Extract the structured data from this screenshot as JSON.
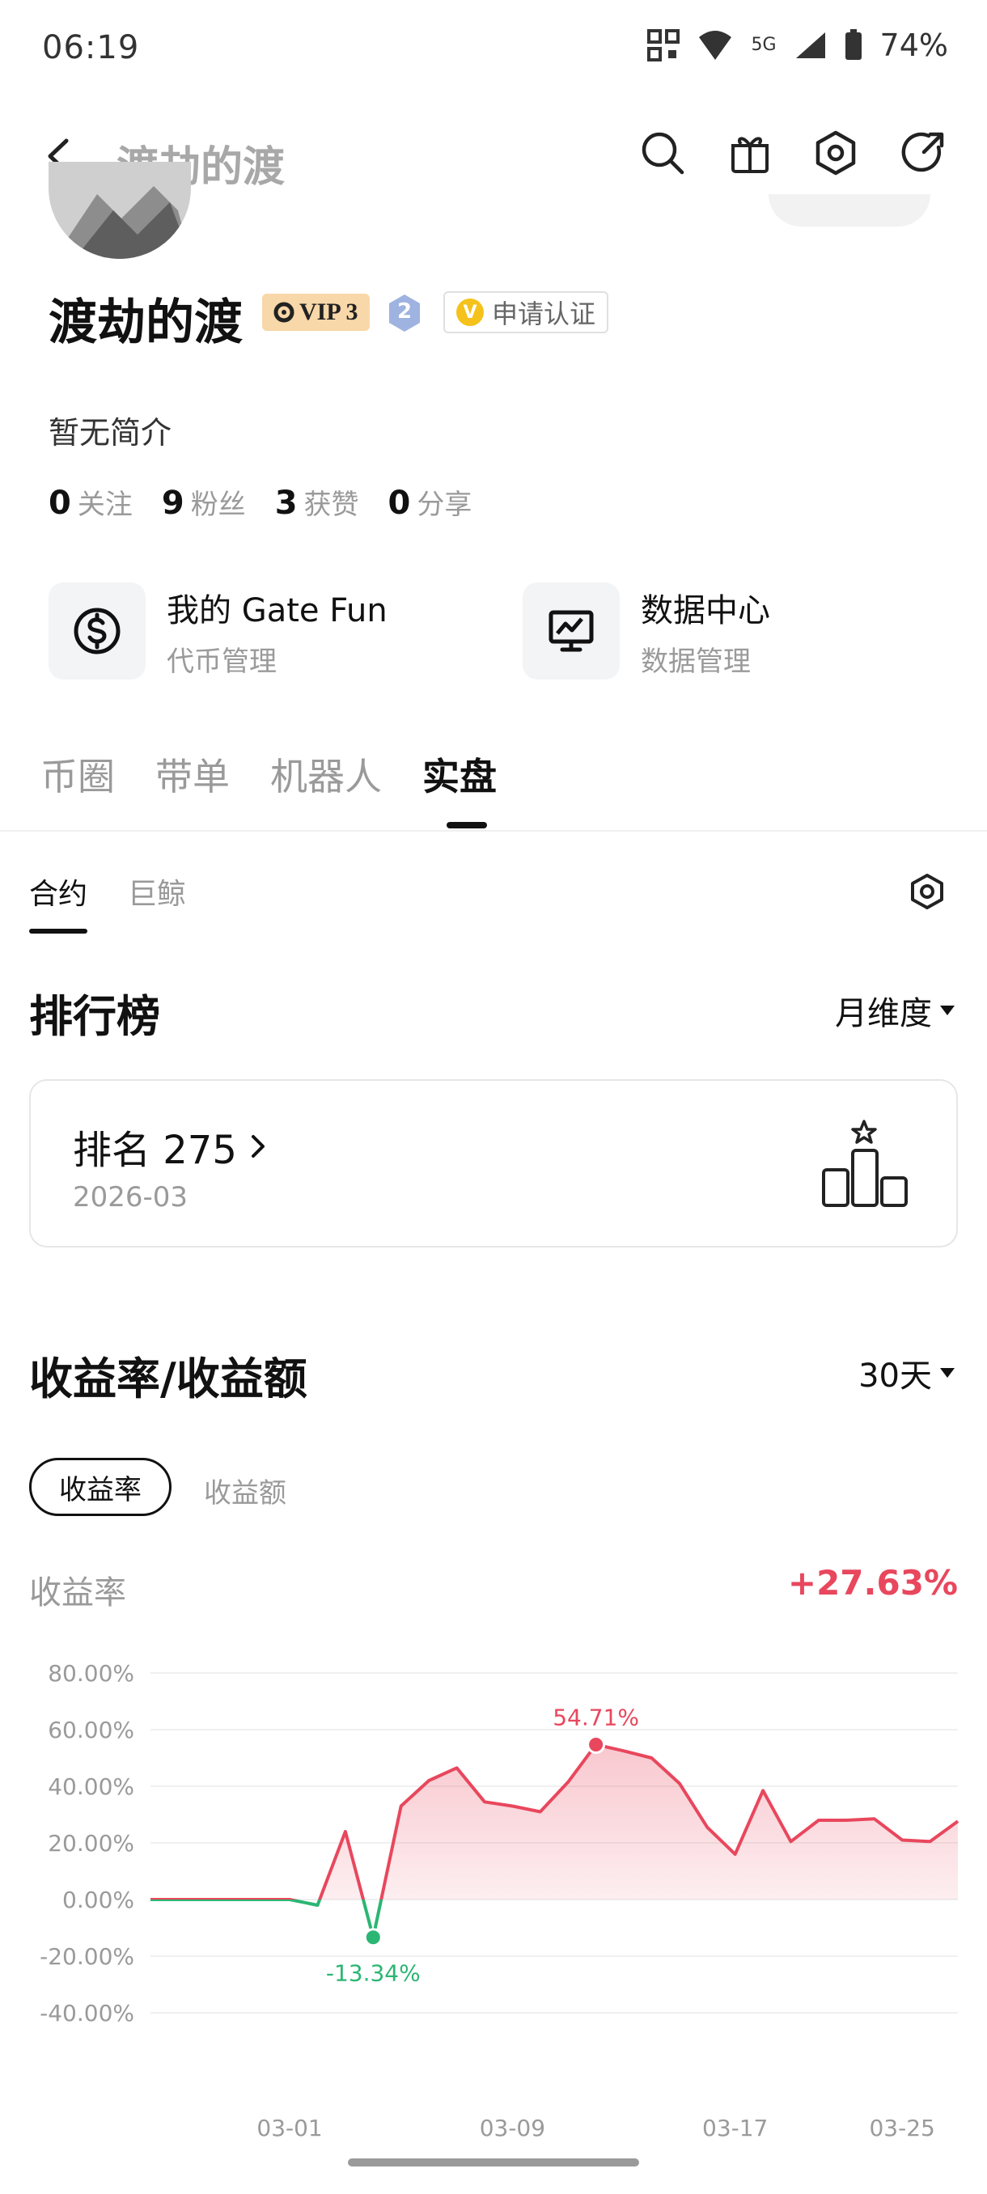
{
  "status_bar": {
    "time": "06:19",
    "network": "5G",
    "battery": "74%"
  },
  "header": {
    "title": "渡劫的渡"
  },
  "profile": {
    "username": "渡劫的渡",
    "vip": "VIP 3",
    "level": "2",
    "verify_icon_letter": "V",
    "verify_label": "申请认证",
    "bio": "暂无简介",
    "stats": [
      {
        "value": "0",
        "label": "关注"
      },
      {
        "value": "9",
        "label": "粉丝"
      },
      {
        "value": "3",
        "label": "获赞"
      },
      {
        "value": "0",
        "label": "分享"
      }
    ]
  },
  "tools": [
    {
      "title": "我的 Gate Fun",
      "subtitle": "代币管理",
      "icon": "dollar-circle-icon"
    },
    {
      "title": "数据中心",
      "subtitle": "数据管理",
      "icon": "monitor-chart-icon"
    }
  ],
  "main_tabs": [
    "币圈",
    "带单",
    "机器人",
    "实盘"
  ],
  "active_main_tab": "实盘",
  "sub_tabs": [
    "合约",
    "巨鲸"
  ],
  "ranking": {
    "title": "排行榜",
    "period": "月维度",
    "rank_label": "排名 275",
    "month": "2026-03"
  },
  "profit": {
    "title": "收益率/收益额",
    "period": "30天",
    "toggle_active": "收益率",
    "toggle_other": "收益额",
    "metric_label": "收益率",
    "metric_value": "+27.63%"
  },
  "colors": {
    "positive": "#e8475d",
    "negative": "#2bb673",
    "accent": "#111111"
  },
  "chart_data": {
    "type": "line",
    "y_tick_labels": [
      "80.00%",
      "60.00%",
      "40.00%",
      "20.00%",
      "0.00%",
      "-20.00%",
      "-40.00%"
    ],
    "ylim": [
      -40,
      80
    ],
    "x_tick_labels": [
      "03-01",
      "03-09",
      "03-17",
      "03-25"
    ],
    "x_tick_index": [
      5,
      13,
      21,
      27
    ],
    "series": [
      {
        "values": [
          0,
          0,
          0,
          0,
          0,
          0,
          -2,
          24,
          -13.34,
          33,
          42,
          46.5,
          34.5,
          33,
          31,
          41.5,
          54.71,
          52.5,
          50,
          41,
          25.5,
          16,
          38.5,
          20.5,
          28,
          28,
          28.5,
          21,
          20.5,
          27.63
        ]
      }
    ],
    "annotations": [
      {
        "index": 16,
        "label": "54.71%"
      },
      {
        "index": 8,
        "label": "-13.34%"
      }
    ]
  }
}
